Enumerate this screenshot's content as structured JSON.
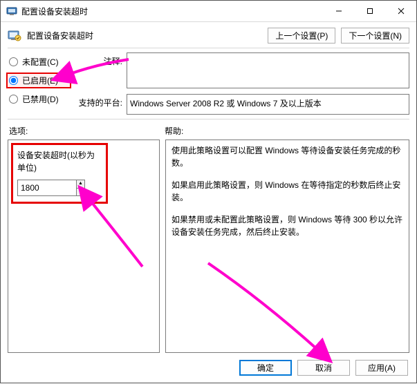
{
  "window": {
    "title": "配置设备安装超时"
  },
  "subheader": {
    "title": "配置设备安装超时",
    "prev": "上一个设置(P)",
    "next": "下一个设置(N)"
  },
  "state": {
    "not_configured": "未配置(C)",
    "enabled": "已启用(E)",
    "disabled": "已禁用(D)"
  },
  "labels": {
    "comment": "注释:",
    "platform": "支持的平台:",
    "options": "选项:",
    "help": "帮助:"
  },
  "platform_text": "Windows Server 2008 R2 或 Windows 7 及以上版本",
  "option": {
    "label": "设备安装超时(以秒为单位)",
    "value": "1800"
  },
  "help": {
    "p1": "使用此策略设置可以配置 Windows 等待设备安装任务完成的秒数。",
    "p2": "如果启用此策略设置，则 Windows 在等待指定的秒数后终止安装。",
    "p3": "如果禁用或未配置此策略设置，则 Windows 等待 300 秒以允许设备安装任务完成，然后终止安装。"
  },
  "buttons": {
    "ok": "确定",
    "cancel": "取消",
    "apply": "应用(A)"
  },
  "annotation_color": "#ff00cc"
}
